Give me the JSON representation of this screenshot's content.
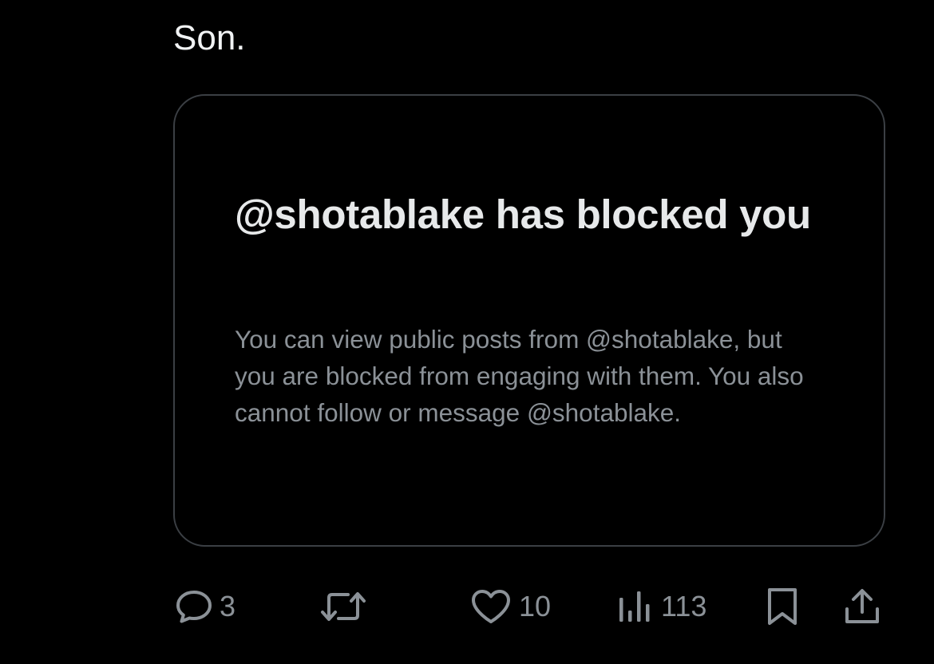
{
  "post": {
    "text": "Son."
  },
  "quote_card": {
    "title": "@shotablake has blocked you",
    "description": "You can view public posts from @shotablake, but you are blocked from engaging with them. You also cannot follow or message @shotablake."
  },
  "actions": {
    "reply_count": "3",
    "repost_count": "",
    "like_count": "10",
    "views_count": "113"
  },
  "icons": {
    "reply": "reply-bubble-icon",
    "repost": "repost-arrows-icon",
    "like": "heart-icon",
    "views": "analytics-bars-icon",
    "bookmark": "bookmark-icon",
    "share": "share-upload-icon"
  },
  "colors": {
    "background": "#000000",
    "text_primary": "#e7e9ea",
    "text_secondary": "#8b9197",
    "card_border": "#3b3f44"
  }
}
